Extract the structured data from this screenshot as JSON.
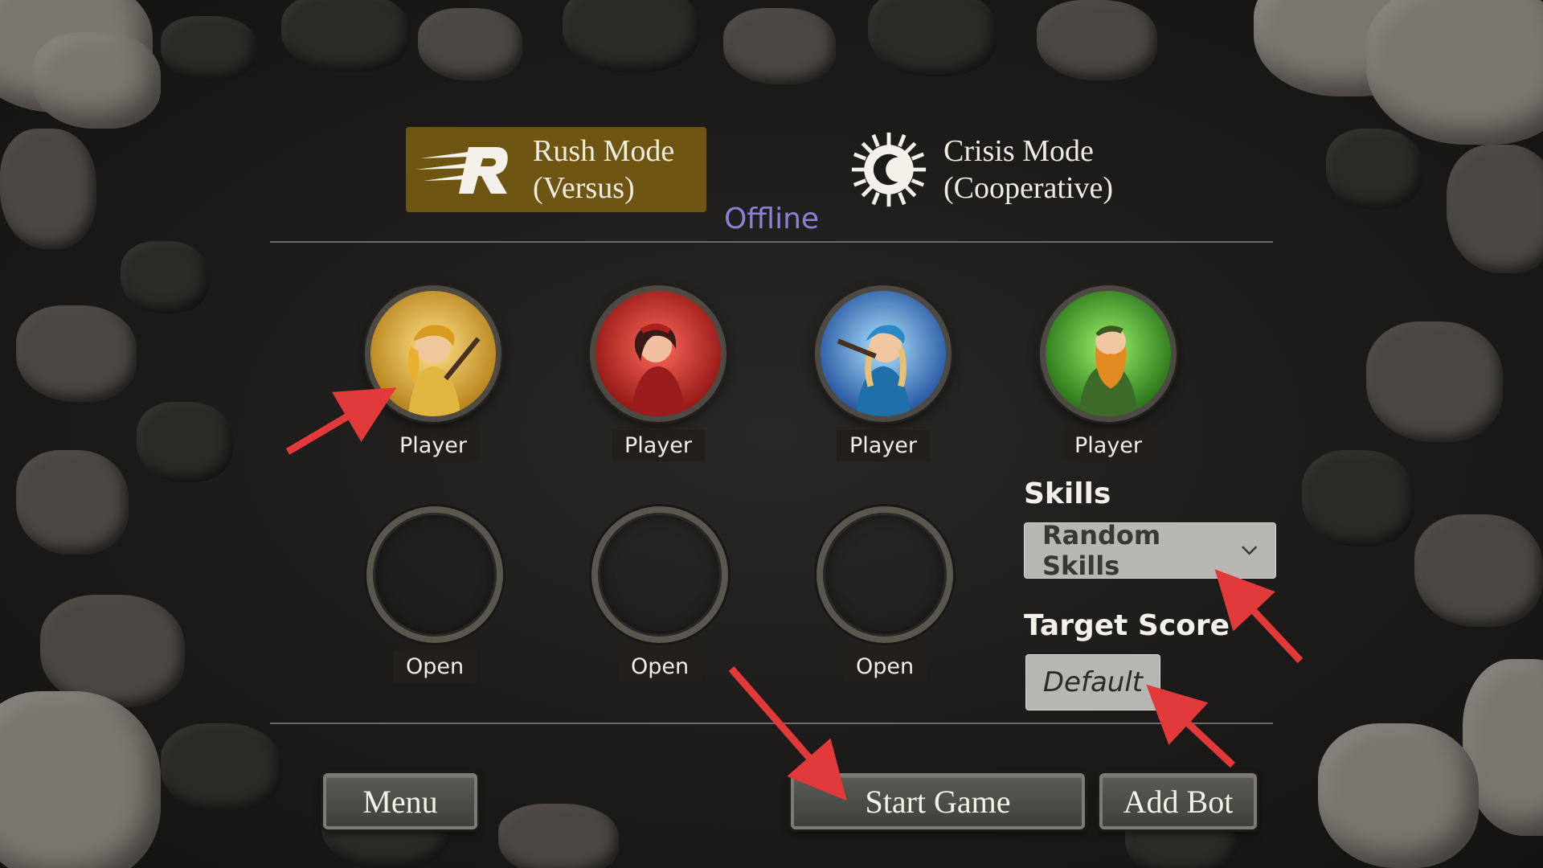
{
  "modes": {
    "rush": {
      "label": "Rush Mode\n(Versus)",
      "selected": true
    },
    "crisis": {
      "label": "Crisis Mode\n(Cooperative)",
      "selected": false
    }
  },
  "connection_status": "Offline",
  "player_slots": [
    {
      "label": "Player",
      "color": "#d8a62a"
    },
    {
      "label": "Player",
      "color": "#c42a26"
    },
    {
      "label": "Player",
      "color": "#2a77c8"
    },
    {
      "label": "Player",
      "color": "#3f9a2c"
    }
  ],
  "open_slots": [
    {
      "label": "Open"
    },
    {
      "label": "Open"
    },
    {
      "label": "Open"
    }
  ],
  "settings": {
    "skills_heading": "Skills",
    "skills_value": "Random Skills",
    "target_score_heading": "Target Score",
    "target_score_value": "Default"
  },
  "buttons": {
    "menu": "Menu",
    "start_game": "Start Game",
    "add_bot": "Add Bot"
  },
  "colors": {
    "accent_selected_mode": "#6e5512",
    "status_text": "#8b82d6",
    "annotation_arrow": "#e23a3a"
  }
}
